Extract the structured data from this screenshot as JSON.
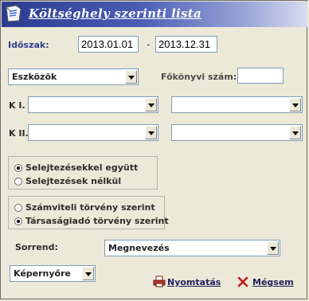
{
  "window": {
    "title": "Költséghely szerinti lista"
  },
  "period": {
    "label": "Időszak:",
    "from": "2013.01.01",
    "separator": "-",
    "to": "2013.12.31"
  },
  "asset_combo": {
    "value": "Eszközök"
  },
  "ledger": {
    "label": "Főkönyvi szám:",
    "value": ""
  },
  "k1": {
    "label": "K I.",
    "left": "",
    "right": ""
  },
  "k2": {
    "label": "K II.",
    "left": "",
    "right": ""
  },
  "scrapping": {
    "options": [
      {
        "label": "Selejtezésekkel együtt",
        "selected": true
      },
      {
        "label": "Selejtezések nélkül",
        "selected": false
      }
    ]
  },
  "law": {
    "options": [
      {
        "label": "Számviteli törvény szerint",
        "selected": false
      },
      {
        "label": "Társaságiadó törvény szerint",
        "selected": true
      }
    ]
  },
  "order": {
    "label": "Sorrend:",
    "value": "Megnevezés"
  },
  "output": {
    "value": "Képernyőre"
  },
  "buttons": {
    "print": "Nyomtatás",
    "cancel": "Mégsem"
  },
  "icons": {
    "app": "document-list-icon",
    "print": "printer-icon",
    "cancel": "close-x-icon"
  }
}
